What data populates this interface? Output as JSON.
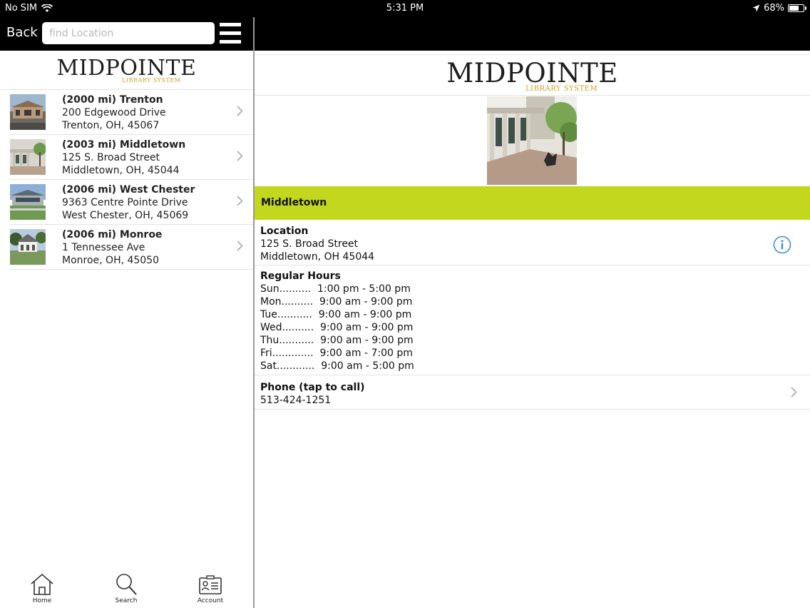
{
  "status_bar": {
    "carrier": "No SIM",
    "time": "5:31 PM",
    "battery": "68%",
    "battery_level": 0.68
  },
  "left_pane": {
    "back_label": "Back",
    "search": {
      "placeholder": "find Location",
      "value": ""
    },
    "logo": {
      "main": "MIDPOINTE",
      "sub": "LIBRARY SYSTEM"
    },
    "locations": [
      {
        "title": "(2000 mi) Trenton",
        "street": "200 Edgewood Drive",
        "city": "Trenton, OH, 45067"
      },
      {
        "title": "(2003 mi) Middletown",
        "street": "125 S. Broad Street",
        "city": "Middletown, OH, 45044"
      },
      {
        "title": "(2006 mi) West Chester",
        "street": "9363 Centre Pointe Drive",
        "city": "West Chester, OH, 45069"
      },
      {
        "title": "(2006 mi) Monroe",
        "street": "1 Tennessee Ave",
        "city": "Monroe, OH, 45050"
      }
    ],
    "tabs": [
      {
        "label": "Home",
        "icon": "home-icon"
      },
      {
        "label": "Search",
        "icon": "search-icon"
      },
      {
        "label": "Account",
        "icon": "account-card-icon"
      }
    ]
  },
  "detail": {
    "logo": {
      "main": "MIDPOINTE",
      "sub": "LIBRARY SYSTEM"
    },
    "branch_name": "Middletown",
    "location": {
      "title": "Location",
      "street": "125 S. Broad Street",
      "city": "Middletown, OH 45044"
    },
    "hours": {
      "title": "Regular Hours",
      "rows": [
        {
          "day": "Sun..........",
          "time": "1:00 pm - 5:00 pm"
        },
        {
          "day": "Mon..........",
          "time": "9:00 am - 9:00 pm"
        },
        {
          "day": "Tue...........",
          "time": "9:00 am - 9:00 pm"
        },
        {
          "day": "Wed..........",
          "time": "9:00 am - 9:00 pm"
        },
        {
          "day": "Thu...........",
          "time": "9:00 am - 9:00 pm"
        },
        {
          "day": "Fri.............",
          "time": "9:00 am - 7:00 pm"
        },
        {
          "day": "Sat............",
          "time": "9:00 am - 5:00 pm"
        }
      ]
    },
    "phone": {
      "title": "Phone (tap to call)",
      "number": "513-424-1251"
    }
  },
  "colors": {
    "accent_band": "#c3d71e",
    "info_icon": "#3a8fd6",
    "logo_gold": "#c9a227"
  }
}
